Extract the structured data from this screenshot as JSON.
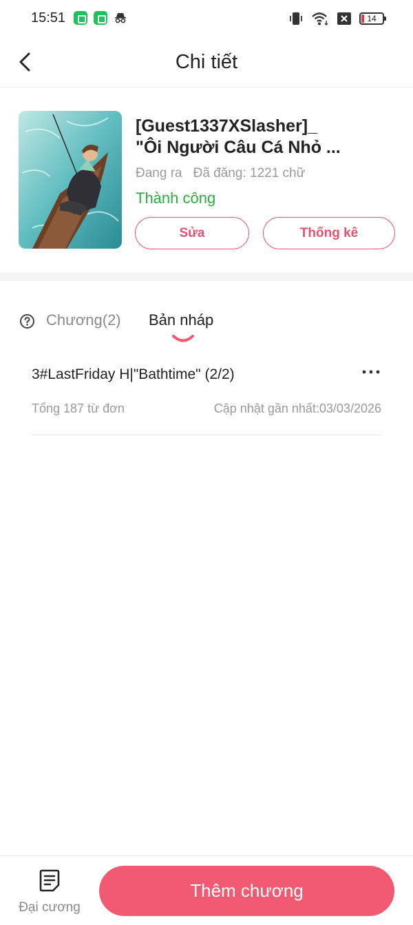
{
  "status_bar": {
    "time": "15:51",
    "battery": "14",
    "icons": [
      "app-icon",
      "app-icon",
      "incognito-icon",
      "vibrate-icon",
      "wifi-icon",
      "sim-x-icon",
      "battery-icon"
    ]
  },
  "header": {
    "title": "Chi tiết",
    "back_icon": "chevron-left-icon"
  },
  "book": {
    "title": "[Guest1337XSlasher]_\n\"Ôi Người Câu Cá Nhỏ ...",
    "state": "Đang ra",
    "published_words": "Đã đăng: 1221 chữ",
    "status": "Thành công",
    "status_color": "#2cae3d",
    "edit_label": "Sửa",
    "stats_label": "Thống kê"
  },
  "tabs": {
    "help_icon": "question-circle-icon",
    "chapters_label": "Chương(2)",
    "drafts_label": "Bản nháp",
    "active": "drafts"
  },
  "drafts": [
    {
      "title": "3#LastFriday H|\"Bathtime\" (2/2)",
      "word_count": "Tổng 187 từ đơn",
      "updated": "Cập nhật gần nhất:03/03/2026"
    }
  ],
  "bottom_bar": {
    "outline_label": "Đại cương",
    "outline_icon": "document-list-icon",
    "add_chapter_label": "Thêm chương"
  },
  "colors": {
    "accent": "#e25471",
    "primary_button": "#f25a72",
    "success": "#2cae3d"
  }
}
